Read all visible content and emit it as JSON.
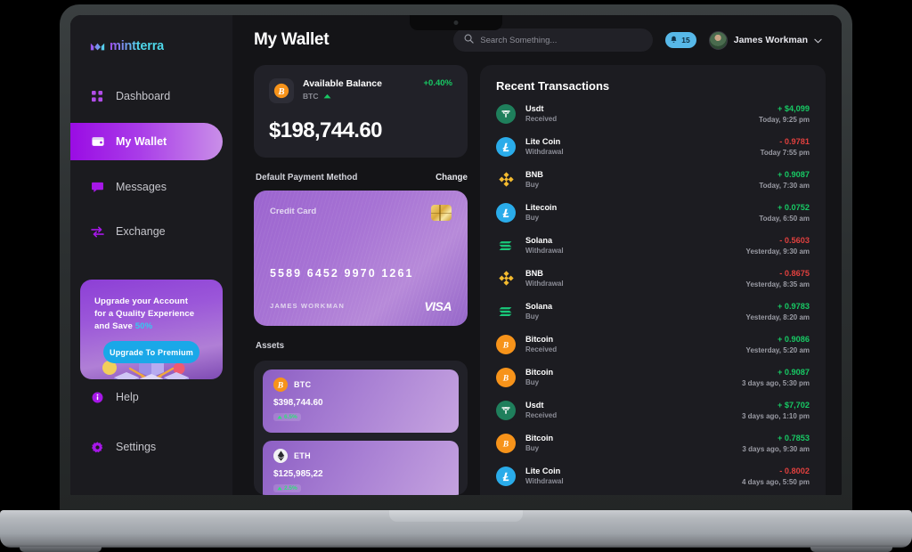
{
  "brand": {
    "name": "mintterra",
    "logo_icon": "mintterra-logo-icon"
  },
  "sidebar": {
    "items": [
      {
        "label": "Dashboard",
        "icon": "grid-icon",
        "active": false
      },
      {
        "label": "My Wallet",
        "icon": "wallet-icon",
        "active": true
      },
      {
        "label": "Messages",
        "icon": "chat-icon",
        "active": false
      },
      {
        "label": "Exchange",
        "icon": "exchange-arrows-icon",
        "active": false
      }
    ],
    "promo": {
      "line1": "Upgrade your Account",
      "line2": "for a Quality Experience",
      "line3": "and Save ",
      "highlight": "50%",
      "button": "Upgrade To Premium",
      "art_icon": "isometric-cubes-illustration"
    },
    "bottom": [
      {
        "label": "Help",
        "icon": "info-circle-icon"
      },
      {
        "label": "Settings",
        "icon": "gear-icon"
      }
    ]
  },
  "header": {
    "title": "My Wallet",
    "search": {
      "placeholder": "Search Something...",
      "value": "",
      "icon": "search-icon"
    },
    "notifications": {
      "count": "15",
      "icon": "bell-icon"
    },
    "user": {
      "name": "James Workman",
      "avatar": "user-avatar",
      "caret": "chevron-down-icon"
    }
  },
  "balance": {
    "label": "Available Balance",
    "symbol": "BTC",
    "trend_icon": "triangle-up-icon",
    "change": "+0.40%",
    "amount": "$198,744.60",
    "coin_icon": "bitcoin-icon"
  },
  "payment": {
    "section_label": "Default Payment Method",
    "change_label": "Change",
    "card": {
      "type": "Credit Card",
      "number": "5589 6452 9970 1261",
      "holder": "JAMES WORKMAN",
      "brand": "VISA",
      "chip_icon": "emv-chip-icon"
    }
  },
  "assets": {
    "section_label": "Assets",
    "items": [
      {
        "symbol": "BTC",
        "value": "$398,744.60",
        "change": "6.5%",
        "icon": "bitcoin-icon"
      },
      {
        "symbol": "ETH",
        "value": "$125,985,22",
        "change": "2.5%",
        "icon": "ethereum-icon"
      }
    ]
  },
  "transactions": {
    "title": "Recent Transactions",
    "items": [
      {
        "name": "Usdt",
        "type": "Received",
        "amount": "+ $4,099",
        "sign": "pos",
        "time": "Today, 9:25 pm",
        "icon": "tether-icon"
      },
      {
        "name": "Lite Coin",
        "type": "Withdrawal",
        "amount": "- 0.9781",
        "sign": "neg",
        "time": "Today 7:55 pm",
        "icon": "litecoin-icon"
      },
      {
        "name": "BNB",
        "type": "Buy",
        "amount": "+ 0.9087",
        "sign": "pos",
        "time": "Today, 7:30 am",
        "icon": "bnb-icon"
      },
      {
        "name": "Litecoin",
        "type": "Buy",
        "amount": "+ 0.0752",
        "sign": "pos",
        "time": "Today, 6:50 am",
        "icon": "litecoin-icon"
      },
      {
        "name": "Solana",
        "type": "Withdrawal",
        "amount": "- 0.5603",
        "sign": "neg",
        "time": "Yesterday, 9:30 am",
        "icon": "solana-icon"
      },
      {
        "name": "BNB",
        "type": "Withdrawal",
        "amount": "- 0.8675",
        "sign": "neg",
        "time": "Yesterday, 8:35 am",
        "icon": "bnb-icon"
      },
      {
        "name": "Solana",
        "type": "Buy",
        "amount": "+ 0.9783",
        "sign": "pos",
        "time": "Yesterday, 8:20 am",
        "icon": "solana-icon"
      },
      {
        "name": "Bitcoin",
        "type": "Received",
        "amount": "+ 0.9086",
        "sign": "pos",
        "time": "Yesterday, 5:20 am",
        "icon": "bitcoin-icon"
      },
      {
        "name": "Bitcoin",
        "type": "Buy",
        "amount": "+ 0.9087",
        "sign": "pos",
        "time": "3 days ago, 5:30 pm",
        "icon": "bitcoin-icon"
      },
      {
        "name": "Usdt",
        "type": "Received",
        "amount": "+ $7,702",
        "sign": "pos",
        "time": "3 days ago, 1:10 pm",
        "icon": "tether-icon"
      },
      {
        "name": "Bitcoin",
        "type": "Buy",
        "amount": "+ 0.7853",
        "sign": "pos",
        "time": "3 days ago, 9:30 am",
        "icon": "bitcoin-icon"
      },
      {
        "name": "Lite Coin",
        "type": "Withdrawal",
        "amount": "- 0.8002",
        "sign": "neg",
        "time": "4 days ago, 5:50 pm",
        "icon": "litecoin-icon"
      }
    ]
  },
  "colors": {
    "accent_purple": "#9a0ce4",
    "accent_cyan": "#1aa8e8",
    "positive": "#17c964",
    "negative": "#e0403e",
    "bg_app": "#141417",
    "bg_sidebar": "#1b1b1f",
    "bg_card": "#212128"
  }
}
